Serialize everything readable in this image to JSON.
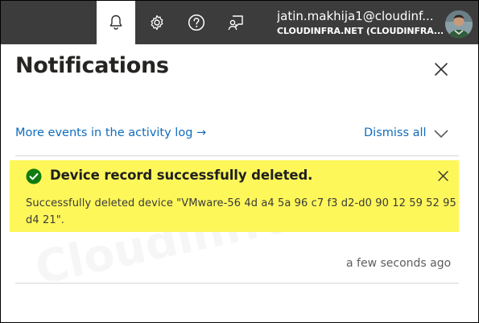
{
  "topbar": {
    "icons": [
      "bell-icon",
      "gear-icon",
      "help-icon",
      "feedback-icon"
    ],
    "account": {
      "email": "jatin.makhija1@cloudinf...",
      "tenant": "CLOUDINFRA.NET (CLOUDINFRA..."
    }
  },
  "panel": {
    "title": "Notifications",
    "activity_link": "More events in the activity log",
    "activity_arrow": "→",
    "dismiss_all": "Dismiss all"
  },
  "notification": {
    "title": "Device record successfully deleted.",
    "body": "Successfully deleted device \"VMware-56 4d a4 5a 96 c7 f3 d2-d0 90 12 59 52 95 d4 21\".",
    "timestamp": "a few seconds ago",
    "status": "success",
    "highlight_color": "#fdf75a",
    "success_color": "#107c10"
  },
  "watermark": "Cloudinfra.net",
  "colors": {
    "topbar": "#3d3c3c",
    "link": "#0f6cbd"
  }
}
